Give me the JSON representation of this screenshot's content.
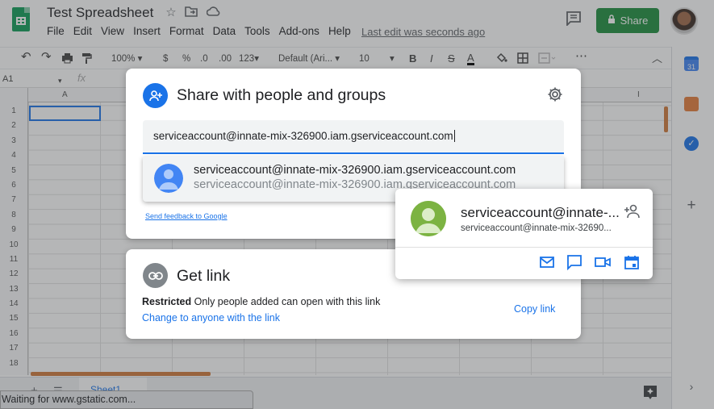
{
  "app": {
    "doc_title": "Test Spreadsheet",
    "share_label": "Share",
    "last_edit": "Last edit was seconds ago",
    "menu": [
      "File",
      "Edit",
      "View",
      "Insert",
      "Format",
      "Data",
      "Tools",
      "Add-ons",
      "Help"
    ]
  },
  "toolbar": {
    "zoom": "100%",
    "currency": "$",
    "percent": "%",
    "decrease_decimals": ".0",
    "increase_decimals": ".00",
    "more_formats": "123",
    "font": "Default (Ari...",
    "font_size": "10",
    "bold": "B"
  },
  "formula_bar": {
    "name_box": "A1",
    "fx": "fx"
  },
  "grid": {
    "columns": [
      "A",
      "I"
    ],
    "rows": [
      "1",
      "2",
      "3",
      "4",
      "5",
      "6",
      "7",
      "8",
      "9",
      "10",
      "11",
      "12",
      "13",
      "14",
      "15",
      "16",
      "17",
      "18"
    ]
  },
  "sheet_tab": "Sheet1",
  "status_text": "Waiting for www.gstatic.com...",
  "share_dialog": {
    "title": "Share with people and groups",
    "input_value": "serviceaccount@innate-mix-326900.iam.gserviceaccount.com",
    "suggestion_primary": "serviceaccount@innate-mix-326900.iam.gserviceaccount.com",
    "suggestion_secondary": "serviceaccount@innate-mix-326900.iam.gserviceaccount.com",
    "feedback": "Send feedback to Google"
  },
  "link_dialog": {
    "title": "Get link",
    "restricted_label": "Restricted",
    "restricted_desc": "Only people added can open with this link",
    "change_link": "Change to anyone with the link",
    "copy_link": "Copy link"
  },
  "hover_card": {
    "name": "serviceaccount@innate-...",
    "email": "serviceaccount@innate-mix-32690..."
  },
  "colors": {
    "accent": "#1a73e8",
    "share_green": "#1e8e3e",
    "avatar_green": "#7cb342"
  }
}
